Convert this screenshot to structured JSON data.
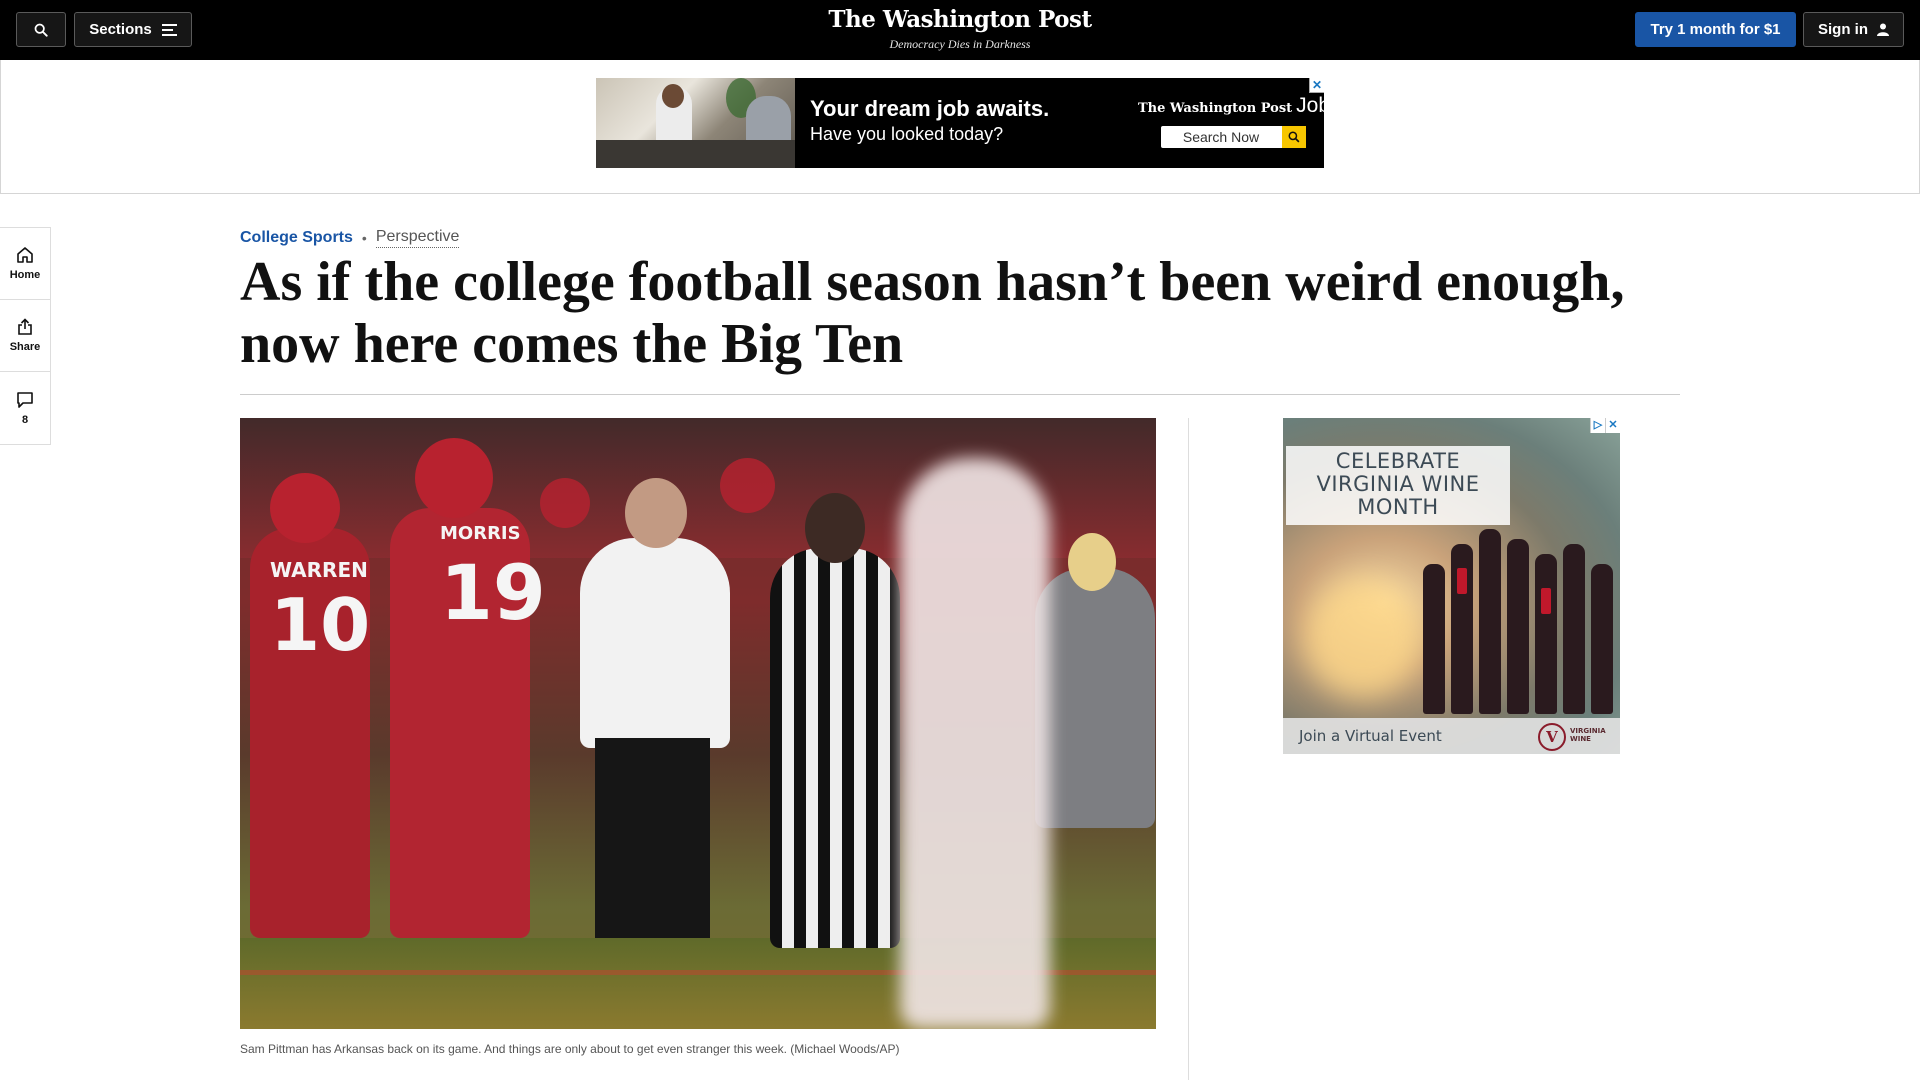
{
  "topbar": {
    "sections_label": "Sections",
    "masthead": "The Washington Post",
    "tagline": "Democracy Dies in Darkness",
    "try_label": "Try 1 month for $1",
    "signin_label": "Sign in",
    "search_icon": "search-icon",
    "menu_icon": "hamburger-menu-icon",
    "user_icon": "user-icon",
    "accent_color": "#1955a5"
  },
  "top_ad": {
    "headline": "Your dream job awaits.",
    "subline": "Have you looked today?",
    "brand": "The Washington Post",
    "brand_suffix": "Jobs",
    "search_label": "Search Now",
    "adchoices_icon": "close-x-icon",
    "adchoices_glyph": "✕"
  },
  "rail": {
    "items": [
      {
        "label": "Home",
        "icon": "home-icon"
      },
      {
        "label": "Share",
        "icon": "share-icon"
      },
      {
        "label": "8",
        "icon": "comment-icon"
      }
    ]
  },
  "article": {
    "section": "College Sports",
    "separator": "•",
    "label": "Perspective",
    "headline": "As if the college football season hasn’t been weird enough, now here comes the Big Ten",
    "caption": "Sam Pittman has Arkansas back on its game. And things are only about to get even stranger this week. (Michael Woods/AP)",
    "jersey_names": [
      "WARREN",
      "MORRIS"
    ],
    "jersey_numbers": [
      "10",
      "19"
    ]
  },
  "side_ad": {
    "title": "CELEBRATE VIRGINIA WINE MONTH",
    "footer": "Join a Virtual Event",
    "logo_glyph": "V",
    "logo_text": "VIRGINIA WINE",
    "adchoices": [
      "▷",
      "✕"
    ]
  }
}
